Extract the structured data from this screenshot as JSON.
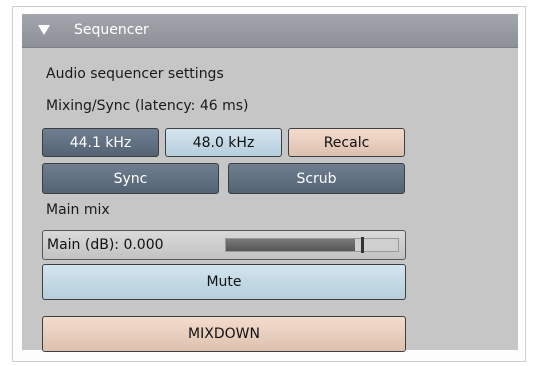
{
  "panel": {
    "title": "Sequencer",
    "description": "Audio sequencer settings",
    "section_label": "Mixing/Sync (latency: 46 ms)"
  },
  "buttons": {
    "rate_44": "44.1 kHz",
    "rate_48": "48.0 kHz",
    "recalc": "Recalc",
    "sync": "Sync",
    "scrub": "Scrub",
    "mute": "Mute",
    "mixdown": "MIXDOWN"
  },
  "main_mix": {
    "label": "Main mix",
    "slider_label": "Main (dB): 0.000",
    "level_fraction": 0.75
  },
  "colors": {
    "header": "#9a9ea4",
    "panel_bg": "#c6c6c6",
    "active_button": "#5f6f7f",
    "light_button": "#c6dae6",
    "accent_button": "#e8cdbb"
  }
}
